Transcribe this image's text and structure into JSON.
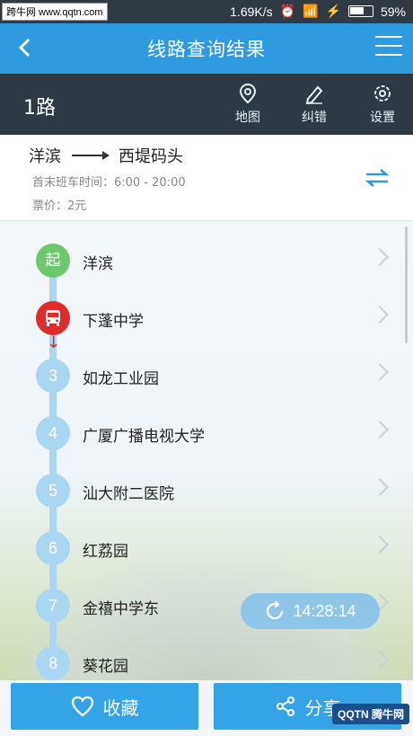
{
  "status_bar": {
    "watermark": "跨牛网 www.qqtn.com",
    "speed": "1.69K/s",
    "battery": "59%"
  },
  "titlebar": {
    "back_icon": "back-arrow-icon",
    "title": "线路查询结果",
    "menu_icon": "hamburger-menu-icon"
  },
  "route": {
    "name": "1路",
    "tools": [
      {
        "label": "地图",
        "icon": "map-pin-icon"
      },
      {
        "label": "纠错",
        "icon": "pencil-icon"
      },
      {
        "label": "设置",
        "icon": "gear-icon"
      }
    ]
  },
  "info": {
    "from": "洋滨",
    "to": "西堤码头",
    "time": "首末班车时间：6:00 - 20:00",
    "fare": "票价：2元"
  },
  "stops": [
    {
      "badge": "起",
      "name": "洋滨",
      "type": "start"
    },
    {
      "badge": "",
      "name": "下蓬中学",
      "type": "bus"
    },
    {
      "badge": "3",
      "name": "如龙工业园",
      "type": "normal"
    },
    {
      "badge": "4",
      "name": "广厦广播电视大学",
      "type": "normal"
    },
    {
      "badge": "5",
      "name": "汕大附二医院",
      "type": "normal"
    },
    {
      "badge": "6",
      "name": "红荔园",
      "type": "normal"
    },
    {
      "badge": "7",
      "name": "金禧中学东",
      "type": "normal"
    },
    {
      "badge": "8",
      "name": "葵花园",
      "type": "normal"
    }
  ],
  "refresh": {
    "time": "14:28:14",
    "icon": "refresh-icon"
  },
  "bottom": {
    "favorite_label": "收藏",
    "share_label": "分享"
  },
  "colors": {
    "accent": "#2f9bdf",
    "header_dark": "#2d3a46",
    "start_green": "#6bc96b",
    "bus_red": "#e02b2b",
    "track_blue": "#a9d6f1"
  }
}
